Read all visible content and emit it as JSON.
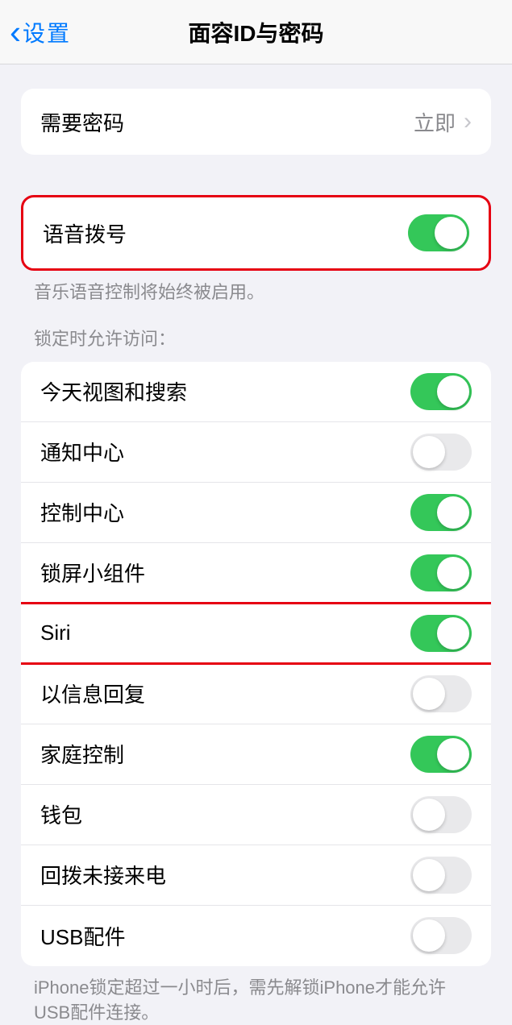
{
  "nav": {
    "back_label": "设置",
    "title": "面容ID与密码"
  },
  "passcode": {
    "label": "需要密码",
    "value": "立即"
  },
  "voice_dial": {
    "label": "语音拨号",
    "on": true,
    "footer": "音乐语音控制将始终被启用。"
  },
  "lock_access": {
    "header": "锁定时允许访问：",
    "items": [
      {
        "label": "今天视图和搜索",
        "on": true
      },
      {
        "label": "通知中心",
        "on": false
      },
      {
        "label": "控制中心",
        "on": true
      },
      {
        "label": "锁屏小组件",
        "on": true
      },
      {
        "label": "Siri",
        "on": true
      },
      {
        "label": "以信息回复",
        "on": false
      },
      {
        "label": "家庭控制",
        "on": true
      },
      {
        "label": "钱包",
        "on": false
      },
      {
        "label": "回拨未接来电",
        "on": false
      },
      {
        "label": "USB配件",
        "on": false
      }
    ],
    "footer": "iPhone锁定超过一小时后，需先解锁iPhone才能允许USB配件连接。"
  }
}
